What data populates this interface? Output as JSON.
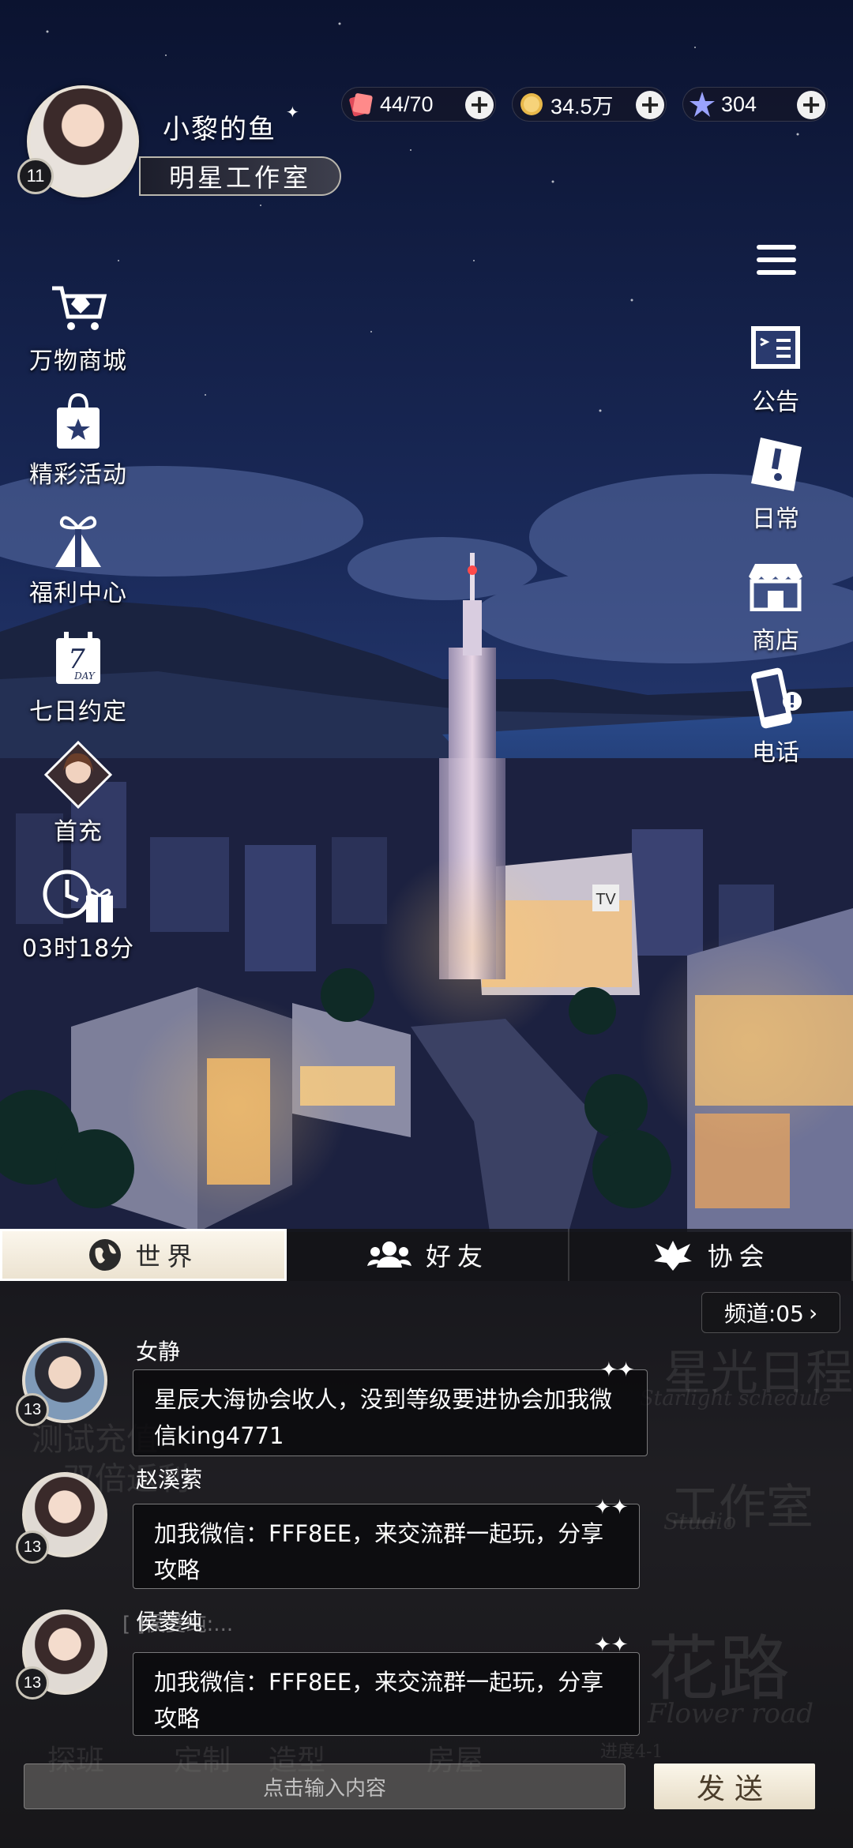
{
  "player": {
    "name": "小黎的鱼",
    "level": "11",
    "studio_label": "明星工作室"
  },
  "resources": {
    "stamina": "44/70",
    "gold": "34.5万",
    "stars": "304"
  },
  "left_menu": [
    {
      "label": "万物商城",
      "icon": "shopping-cart-icon"
    },
    {
      "label": "精彩活动",
      "icon": "gift-bag-icon"
    },
    {
      "label": "福利中心",
      "icon": "gift-bow-icon"
    },
    {
      "label": "七日约定",
      "icon": "calendar-7day-icon"
    },
    {
      "label": "首充",
      "icon": "character-portrait-icon"
    },
    {
      "label": "03时18分",
      "icon": "clock-gift-icon"
    }
  ],
  "calendar_text": "7",
  "calendar_day": "DAY",
  "right_menu": [
    {
      "label": "公告",
      "icon": "notice-board-icon"
    },
    {
      "label": "日常",
      "icon": "daily-tag-icon"
    },
    {
      "label": "商店",
      "icon": "store-icon"
    },
    {
      "label": "电话",
      "icon": "phone-icon"
    }
  ],
  "scene_text": {
    "tv_sign": "TV"
  },
  "chat": {
    "tabs": [
      {
        "label": "世界",
        "icon": "globe-icon",
        "active": true
      },
      {
        "label": "好友",
        "icon": "friends-icon",
        "active": false
      },
      {
        "label": "协会",
        "icon": "guild-emblem-icon",
        "active": false
      }
    ],
    "channel": "频道:05",
    "messages": [
      {
        "name": "女静",
        "level": "13",
        "text_line1": "星辰大海协会收人，没到等级要进协会加我微",
        "text_line2": "信king4771"
      },
      {
        "name": "赵溪萦",
        "level": "13",
        "text_line1": "加我微信：FFF8EE，来交流群一起玩，分享",
        "text_line2": "攻略"
      },
      {
        "name": "侯菱纯",
        "level": "13",
        "text_line1": "加我微信：FFF8EE，来交流群一起玩，分享",
        "text_line2": "攻略"
      }
    ],
    "recalled": "[  ]侯菱纯:..."
  },
  "input": {
    "placeholder": "点击输入内容",
    "send": "发送"
  },
  "background_text": {
    "star_schedule": "星光日程",
    "star_schedule_en": "Starlight schedule",
    "studio": "工作室",
    "studio_en": "Studio",
    "flower_road": "花路",
    "flower_road_en": "Flower road",
    "test_charge": "测试充值",
    "double_rebate": "双倍返利",
    "progress": "进度4-1",
    "bottom_nav": [
      "探班",
      "定制",
      "造型",
      "房屋"
    ]
  },
  "colors": {
    "sky_top": "#0d1530",
    "sky_mid": "#1c2c5c",
    "tab_active": "#f6efe0",
    "send_btn": "#f1e8d6"
  }
}
